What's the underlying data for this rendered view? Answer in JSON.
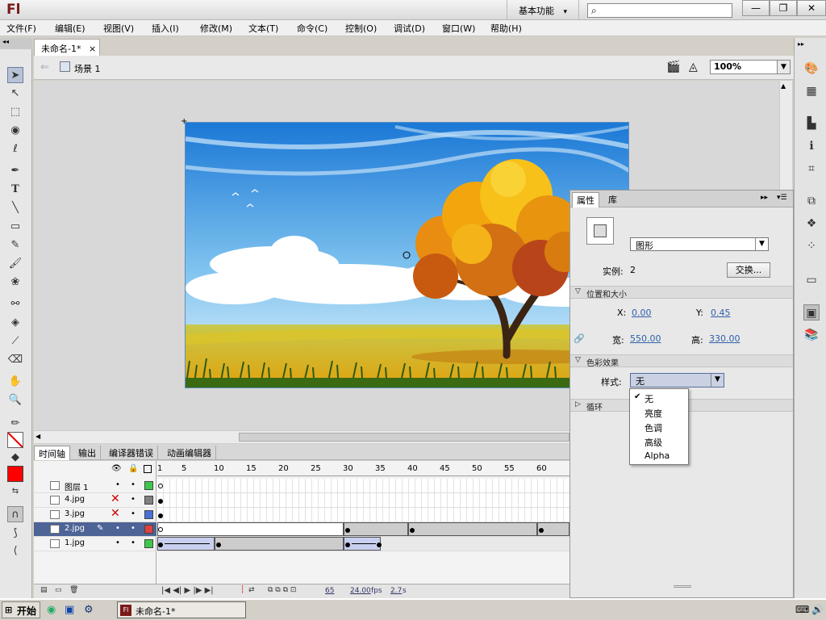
{
  "app": {
    "logo": "Fl",
    "workspace": "基本功能",
    "workspace_arrow": "▾"
  },
  "window_buttons": {
    "minimize": "—",
    "restore": "❐",
    "close": "✕"
  },
  "menu": [
    "文件(F)",
    "编辑(E)",
    "视图(V)",
    "插入(I)",
    "修改(M)",
    "文本(T)",
    "命令(C)",
    "控制(O)",
    "调试(D)",
    "窗口(W)",
    "帮助(H)"
  ],
  "document": {
    "tab_title": "未命名-1*",
    "tab_close": "×",
    "scene": "场景 1",
    "zoom": "100%"
  },
  "timeline": {
    "tabs": [
      "时间轴",
      "输出",
      "编译器错误",
      "动画编辑器"
    ],
    "frame_numbers": [
      "1",
      "5",
      "10",
      "15",
      "20",
      "25",
      "30",
      "35",
      "40",
      "45",
      "50",
      "55",
      "60"
    ],
    "layers": [
      {
        "name": "图层 1",
        "color": "#3cc94a"
      },
      {
        "name": "4.jpg",
        "color": "#808080"
      },
      {
        "name": "3.jpg",
        "color": "#4a70d8"
      },
      {
        "name": "2.jpg",
        "color": "#e04040"
      },
      {
        "name": "1.jpg",
        "color": "#3cc94a"
      }
    ],
    "current_frame": "65",
    "fps": "24.00",
    "fps_unit": "fps",
    "time": "2.7",
    "time_unit": "s"
  },
  "properties": {
    "tabs": [
      "属性",
      "库"
    ],
    "type": "图形",
    "instance_label": "实例:",
    "instance_value": "2",
    "swap_button": "交换...",
    "sections": {
      "position": "位置和大小",
      "color": "色彩效果",
      "loop": "循环"
    },
    "x_label": "X:",
    "x_value": "0.00",
    "y_label": "Y:",
    "y_value": "0.45",
    "w_label": "宽:",
    "w_value": "550.00",
    "h_label": "高:",
    "h_value": "330.00",
    "style_label": "样式:",
    "style_value": "无",
    "style_options": [
      "无",
      "亮度",
      "色调",
      "高级",
      "Alpha"
    ]
  },
  "taskbar": {
    "start": "开始",
    "item": "未命名-1*"
  }
}
